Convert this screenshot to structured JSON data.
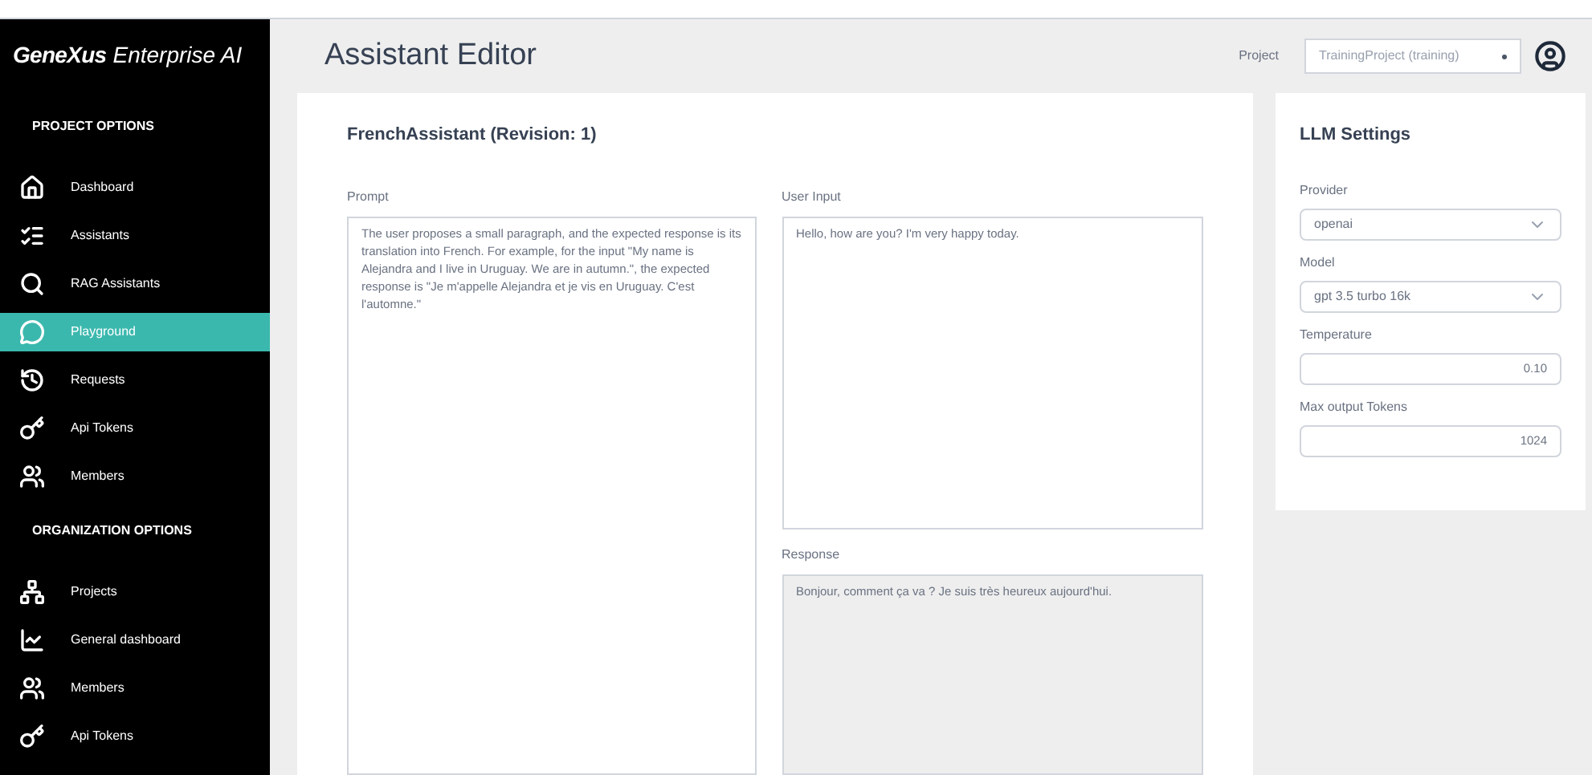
{
  "brand": {
    "name": "GeneXus",
    "suffix": "Enterprise AI"
  },
  "sidebar": {
    "sections": [
      {
        "title": "PROJECT OPTIONS",
        "items": [
          {
            "label": "Dashboard",
            "kind": "home",
            "selected": false
          },
          {
            "label": "Assistants",
            "kind": "list",
            "selected": false
          },
          {
            "label": "RAG Assistants",
            "kind": "search",
            "selected": false
          },
          {
            "label": "Playground",
            "kind": "chat",
            "selected": true
          },
          {
            "label": "Requests",
            "kind": "history",
            "selected": false
          },
          {
            "label": "Api Tokens",
            "kind": "key",
            "selected": false
          },
          {
            "label": "Members",
            "kind": "users",
            "selected": false
          }
        ]
      },
      {
        "title": "ORGANIZATION OPTIONS",
        "items": [
          {
            "label": "Projects",
            "kind": "network",
            "selected": false
          },
          {
            "label": "General dashboard",
            "kind": "chart",
            "selected": false
          },
          {
            "label": "Members",
            "kind": "users",
            "selected": false
          },
          {
            "label": "Api Tokens",
            "kind": "key",
            "selected": false
          }
        ]
      }
    ]
  },
  "header": {
    "title": "Assistant Editor",
    "project_label": "Project",
    "project_value": "TrainingProject (training)"
  },
  "editor": {
    "title": "FrenchAssistant (Revision: 1)",
    "prompt": {
      "label": "Prompt",
      "value": "The user proposes a small paragraph, and the expected response is its translation into French. For example, for the input \"My name is Alejandra and I live in Uruguay. We are in autumn.\", the expected response is \"Je m'appelle Alejandra et je vis en Uruguay. C'est l'automne.\""
    },
    "user_input": {
      "label": "User Input",
      "value": "Hello, how are you? I'm very happy today."
    },
    "response": {
      "label": "Response",
      "value": "Bonjour, comment ça va ? Je suis très heureux aujourd'hui."
    }
  },
  "llm_settings": {
    "title": "LLM Settings",
    "fields": [
      {
        "kind": "select",
        "label": "Provider",
        "value": "openai"
      },
      {
        "kind": "select",
        "label": "Model",
        "value": "gpt 3.5 turbo 16k"
      },
      {
        "kind": "number",
        "label": "Temperature",
        "value": "0.10"
      },
      {
        "kind": "number",
        "label": "Max output Tokens",
        "value": "1024"
      }
    ]
  }
}
